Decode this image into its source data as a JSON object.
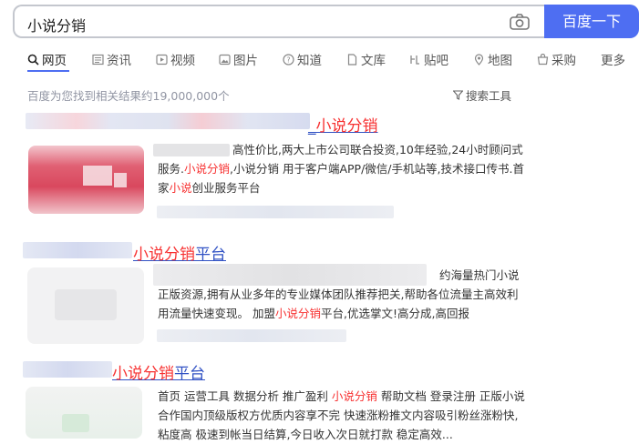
{
  "search": {
    "query": "小说分销",
    "button_label": "百度一下"
  },
  "tabs": [
    {
      "label": "网页",
      "icon": "search-icon"
    },
    {
      "label": "资讯",
      "icon": "news-icon"
    },
    {
      "label": "视频",
      "icon": "video-icon"
    },
    {
      "label": "图片",
      "icon": "image-icon"
    },
    {
      "label": "知道",
      "icon": "question-icon"
    },
    {
      "label": "文库",
      "icon": "document-icon"
    },
    {
      "label": "贴吧",
      "icon": "tieba-icon"
    },
    {
      "label": "地图",
      "icon": "map-pin-icon"
    },
    {
      "label": "采购",
      "icon": "shop-icon"
    },
    {
      "label": "更多",
      "icon": ""
    }
  ],
  "stats": "百度为您找到相关结果约19,000,000个",
  "filter_label": "搜索工具",
  "results": [
    {
      "title_prefix": "_",
      "title_highlight": "小说分销",
      "title_suffix": "",
      "lines": [
        {
          "parts": [
            {
              "t": "高性价比,两大上市公司联合投资,10年经验,24小时顾问式",
              "h": false
            }
          ]
        },
        {
          "parts": [
            {
              "t": "服务.",
              "h": false
            },
            {
              "t": "小说分销",
              "h": true
            },
            {
              "t": ",小说分销 用于客户端APP/微信/手机站等,技术接口传书.首",
              "h": false
            }
          ]
        },
        {
          "parts": [
            {
              "t": "家",
              "h": false
            },
            {
              "t": "小说",
              "h": true
            },
            {
              "t": "创业服务平台",
              "h": false
            }
          ]
        }
      ]
    },
    {
      "title_prefix": "",
      "title_highlight": "小说分销",
      "title_suffix": "平台",
      "lines": [
        {
          "parts": [
            {
              "t": "约海量热门小说",
              "h": false
            }
          ]
        },
        {
          "parts": [
            {
              "t": "正版资源,拥有从业多年的专业媒体团队推荐把关,帮助各位流量主高效利",
              "h": false
            }
          ]
        },
        {
          "parts": [
            {
              "t": "用流量快速变现。 加盟",
              "h": false
            },
            {
              "t": "小说分销",
              "h": true
            },
            {
              "t": "平台,优选掌文!高分成,高回报",
              "h": false
            }
          ]
        }
      ]
    },
    {
      "title_prefix": "",
      "title_highlight": "小说分销",
      "title_suffix": "平台",
      "lines": [
        {
          "parts": [
            {
              "t": "首页 运营工具 数据分析 推广盈利 ",
              "h": false
            },
            {
              "t": "小说分销",
              "h": true
            },
            {
              "t": " 帮助文档 登录注册 正版小说",
              "h": false
            }
          ]
        },
        {
          "parts": [
            {
              "t": "合作国内顶级版权方优质内容享不完 快速涨粉推文内容吸引粉丝涨粉快,",
              "h": false
            }
          ]
        },
        {
          "parts": [
            {
              "t": "粘度高 极速到帐当日结算,今日收入次日就打款 稳定高效...",
              "h": false
            }
          ]
        }
      ]
    }
  ],
  "colors": {
    "accent": "#4e6ef2",
    "link": "#3152c4",
    "highlight": "#f73131"
  }
}
